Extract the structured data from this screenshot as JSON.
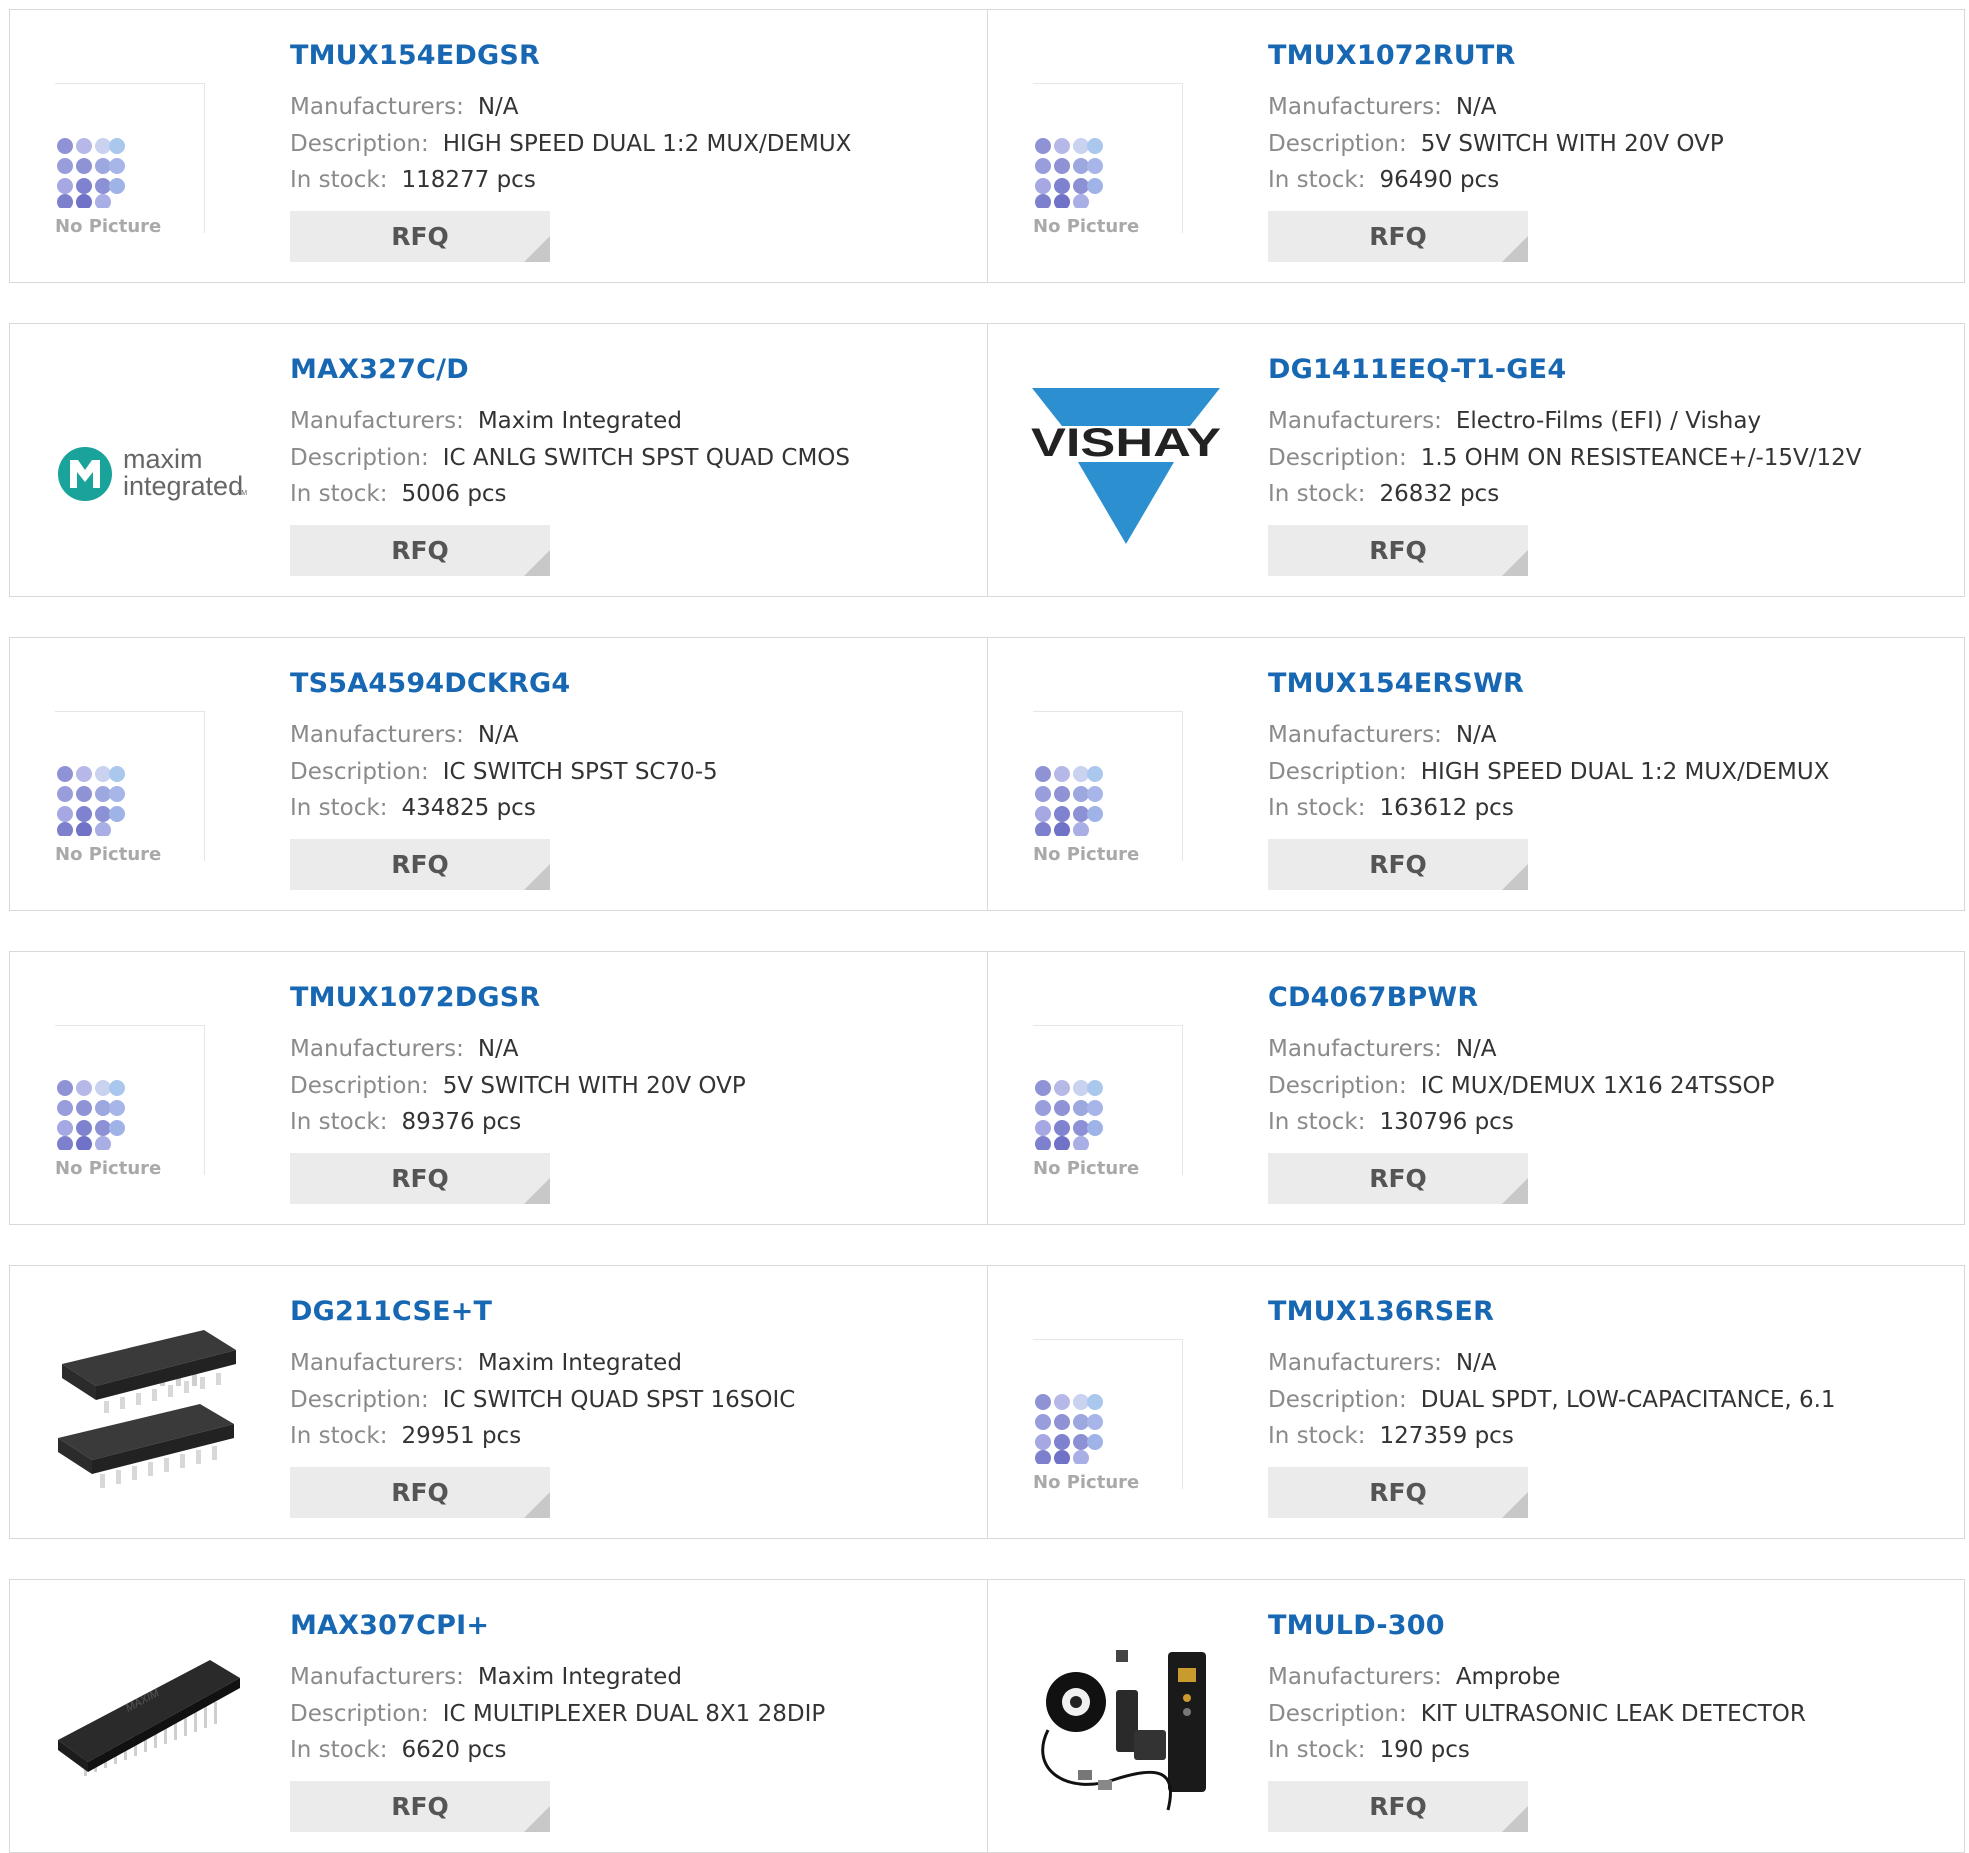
{
  "labels": {
    "manufacturers": "Manufacturers:",
    "description": "Description:",
    "in_stock": "In stock:",
    "rfq": "RFQ",
    "no_picture": "No Picture"
  },
  "rows": [
    {
      "left": {
        "name": "TMUX154EDGSR",
        "manufacturer": "N/A",
        "description": "HIGH SPEED DUAL 1:2 MUX/DEMUX",
        "stock": "118277 pcs",
        "image": "no-picture"
      },
      "right": {
        "name": "TMUX1072RUTR",
        "manufacturer": "N/A",
        "description": "5V SWITCH WITH 20V OVP",
        "stock": "96490 pcs",
        "image": "no-picture"
      }
    },
    {
      "left": {
        "name": "MAX327C/D",
        "manufacturer": "Maxim Integrated",
        "description": "IC ANLG SWITCH SPST QUAD CMOS",
        "stock": "5006 pcs",
        "image": "maxim-logo",
        "logo_text_1": "maxim",
        "logo_text_2": "integrated",
        "logo_tm": "TM"
      },
      "right": {
        "name": "DG1411EEQ-T1-GE4",
        "manufacturer": "Electro-Films (EFI) / Vishay",
        "description": "1.5 OHM ON RESISTEANCE+/-15V/12V",
        "stock": "26832 pcs",
        "image": "vishay-logo",
        "logo_text": "VISHAY"
      }
    },
    {
      "left": {
        "name": "TS5A4594DCKRG4",
        "manufacturer": "N/A",
        "description": "IC SWITCH SPST SC70-5",
        "stock": "434825 pcs",
        "image": "no-picture"
      },
      "right": {
        "name": "TMUX154ERSWR",
        "manufacturer": "N/A",
        "description": "HIGH SPEED DUAL 1:2 MUX/DEMUX",
        "stock": "163612 pcs",
        "image": "no-picture"
      }
    },
    {
      "left": {
        "name": "TMUX1072DGSR",
        "manufacturer": "N/A",
        "description": "5V SWITCH WITH 20V OVP",
        "stock": "89376 pcs",
        "image": "no-picture"
      },
      "right": {
        "name": "CD4067BPWR",
        "manufacturer": "N/A",
        "description": "IC MUX/DEMUX 1X16 24TSSOP",
        "stock": "130796 pcs",
        "image": "no-picture"
      }
    },
    {
      "left": {
        "name": "DG211CSE+T",
        "manufacturer": "Maxim Integrated",
        "description": "IC SWITCH QUAD SPST 16SOIC",
        "stock": "29951 pcs",
        "image": "soic-chips"
      },
      "right": {
        "name": "TMUX136RSER",
        "manufacturer": "N/A",
        "description": "DUAL SPDT, LOW-CAPACITANCE, 6.1",
        "stock": "127359 pcs",
        "image": "no-picture"
      }
    },
    {
      "left": {
        "name": "MAX307CPI+",
        "manufacturer": "Maxim Integrated",
        "description": "IC MULTIPLEXER DUAL 8X1 28DIP",
        "stock": "6620 pcs",
        "image": "dip-chip",
        "chip_marking": "MAXIM"
      },
      "right": {
        "name": "TMULD-300",
        "manufacturer": "Amprobe",
        "description": "KIT ULTRASONIC LEAK DETECTOR",
        "stock": "190 pcs",
        "image": "leak-detector-kit"
      }
    }
  ],
  "colors": {
    "link": "#1767b3",
    "label": "#8a8a8a",
    "value": "#333333",
    "rfq_bg": "#ebebeb",
    "maxim_teal": "#1aa39a",
    "vishay_blue": "#2b8fd0",
    "placeholder_dots": "#8f93d6"
  }
}
